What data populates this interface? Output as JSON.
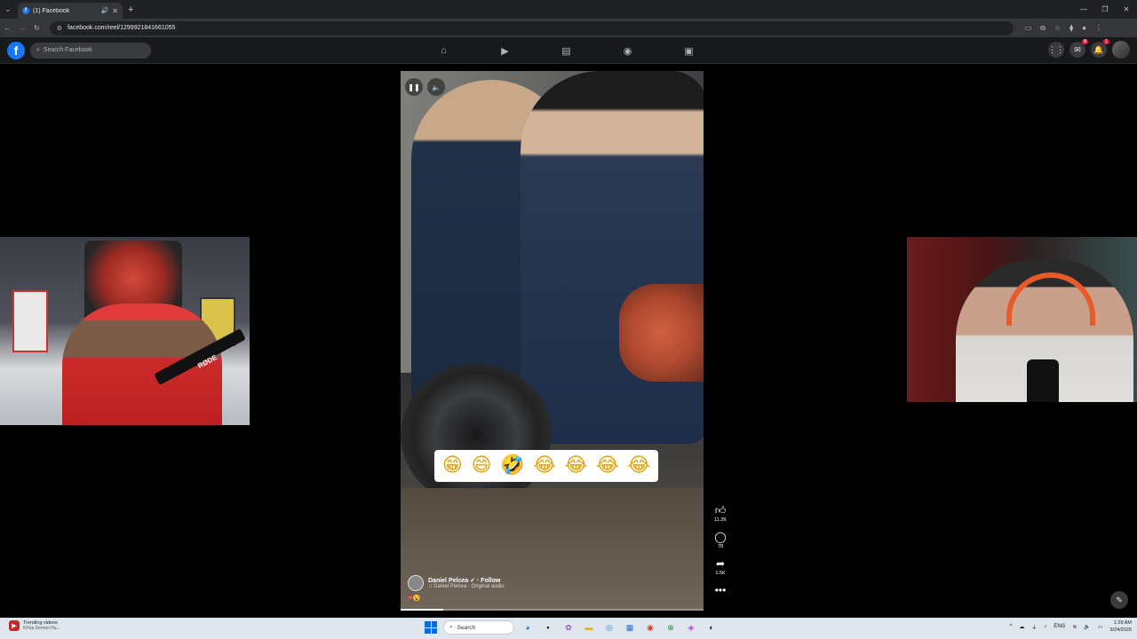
{
  "browser": {
    "tab_title": "(1) Facebook",
    "favicon_letter": "f",
    "url": "facebook.com/reel/1299921841661055"
  },
  "facebook": {
    "logo_letter": "f",
    "search_placeholder": "Search Facebook",
    "nav_icons": [
      "home-icon",
      "video-icon",
      "marketplace-icon",
      "groups-icon",
      "gaming-icon"
    ],
    "messenger_badge": "8",
    "notifications_badge": "1"
  },
  "reel": {
    "emoji_overlay": [
      "😁",
      "😄",
      "🤣",
      "😂",
      "😂",
      "😂",
      "😂"
    ],
    "author_name": "Daniel Pelcea ✓ · Follow",
    "audio_label": "♫ Daniel Pelcea · Original audio",
    "reaction_icons": "❤😮",
    "likes_count": "11.2K",
    "comments_count": "78",
    "shares_count": "1.5K",
    "progress": 0.14
  },
  "webcam_left": {
    "mic_brand": "RØDE"
  },
  "taskbar": {
    "widget_title": "Trending videos",
    "widget_subtitle": "KPop Demon Hu...",
    "search_label": "Search",
    "language": "ENG",
    "time": "1:29 AM",
    "date": "9/24/2025"
  }
}
